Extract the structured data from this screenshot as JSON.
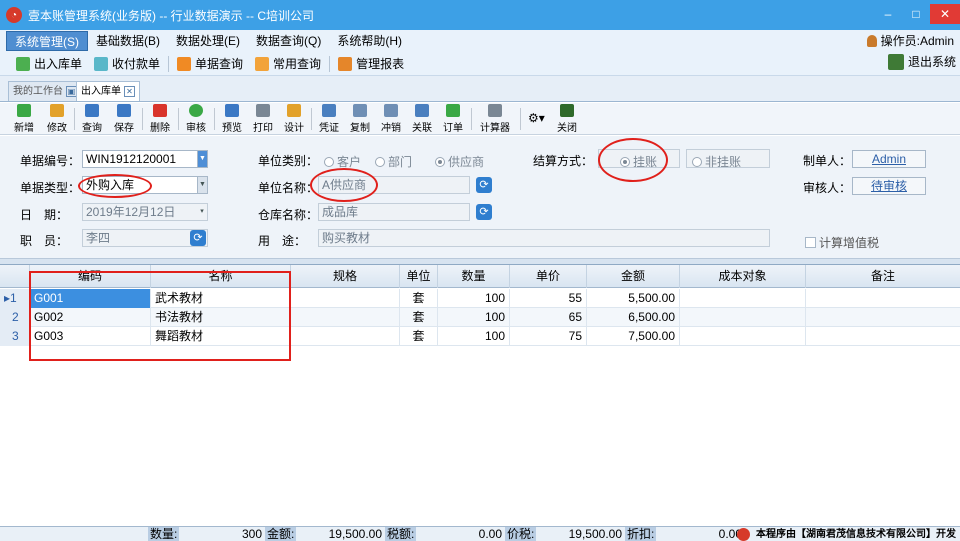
{
  "window": {
    "title": "壹本账管理系统(业务版) -- 行业数据演示 -- C培训公司",
    "minimize": "–",
    "maximize": "□",
    "close": "✕"
  },
  "menu": {
    "items": [
      "系统管理(S)",
      "基础数据(B)",
      "数据处理(E)",
      "数据查询(Q)",
      "系统帮助(H)"
    ],
    "operator": "操作员:Admin"
  },
  "quickbar": {
    "items": [
      {
        "label": "出入库单",
        "color": "#4caf50"
      },
      {
        "label": "收付款单",
        "color": "#59b7c9"
      },
      {
        "label": "单据查询",
        "color": "#f08a24"
      },
      {
        "label": "常用查询",
        "color": "#f2a33a"
      },
      {
        "label": "管理报表",
        "color": "#e5862a"
      }
    ],
    "logout": "退出系统"
  },
  "tabs": [
    {
      "label": "我的工作台",
      "icon": "▣"
    },
    {
      "label": "出入库单",
      "icon": "✕"
    }
  ],
  "actions": [
    {
      "label": "新增",
      "color": "#3aa845"
    },
    {
      "label": "修改",
      "color": "#e2a12a"
    },
    {
      "label": "查询",
      "color": "#3b78c4"
    },
    {
      "label": "保存",
      "color": "#3b78c4"
    },
    {
      "label": "删除",
      "color": "#d9342b"
    },
    {
      "label": "审核",
      "color": "#3aa845"
    },
    {
      "label": "预览",
      "color": "#3b78c4"
    },
    {
      "label": "打印",
      "color": "#7a8794"
    },
    {
      "label": "设计",
      "color": "#e2a12a"
    },
    {
      "label": "凭证",
      "color": "#4a7fbf"
    },
    {
      "label": "复制",
      "color": "#6f8fb5"
    },
    {
      "label": "冲销",
      "color": "#6f8fb5"
    },
    {
      "label": "关联",
      "color": "#4a7fbf"
    },
    {
      "label": "订单",
      "color": "#3aa845"
    },
    {
      "label": "计算器",
      "color": "#7a8794"
    },
    {
      "label": "关闭",
      "color": "#2f6a2a"
    }
  ],
  "form": {
    "doc_no_label": "单据编号：",
    "doc_no": "WIN1912120001",
    "doc_type_label": "单据类型：",
    "doc_type": "外购入库",
    "date_label": "日　期：",
    "date": "2019年12月12日",
    "staff_label": "职　员：",
    "staff": "李四",
    "unit_type_label": "单位类别：",
    "unit_types": [
      "客户",
      "部门",
      "供应商"
    ],
    "unit_type_selected": "供应商",
    "unit_name_label": "单位名称：",
    "unit_name": "A供应商",
    "warehouse_label": "仓库名称：",
    "warehouse": "成品库",
    "purpose_label": "用　途：",
    "purpose": "购买教材",
    "settle_label": "结算方式：",
    "settle_options": [
      "挂账",
      "非挂账"
    ],
    "settle_selected": "挂账",
    "maker_label": "制单人：",
    "maker": "Admin",
    "auditor_label": "审核人：",
    "auditor": "待审核",
    "vat_label": "计算增值税"
  },
  "grid": {
    "columns": [
      "编码",
      "名称",
      "规格",
      "单位",
      "数量",
      "单价",
      "金额",
      "成本对象",
      "备注"
    ],
    "rows": [
      {
        "num": "1",
        "marker": "▸",
        "code": "G001",
        "name": "武术教材",
        "spec": "",
        "unit": "套",
        "qty": "100",
        "price": "55",
        "amount": "5,500.00",
        "cost": "",
        "note": ""
      },
      {
        "num": "2",
        "marker": "",
        "code": "G002",
        "name": "书法教材",
        "spec": "",
        "unit": "套",
        "qty": "100",
        "price": "65",
        "amount": "6,500.00",
        "cost": "",
        "note": ""
      },
      {
        "num": "3",
        "marker": "",
        "code": "G003",
        "name": "舞蹈教材",
        "spec": "",
        "unit": "套",
        "qty": "100",
        "price": "75",
        "amount": "7,500.00",
        "cost": "",
        "note": ""
      }
    ]
  },
  "footer": {
    "qty_label": "数量:",
    "qty": "300",
    "amount_label": "金额:",
    "amount": "19,500.00",
    "tax_label": "税额:",
    "tax": "0.00",
    "total_label": "价税:",
    "total": "19,500.00",
    "discount_label": "折扣:",
    "discount": "0.00",
    "brand": "本程序由【湖南君茂信息技术有限公司】开发"
  }
}
